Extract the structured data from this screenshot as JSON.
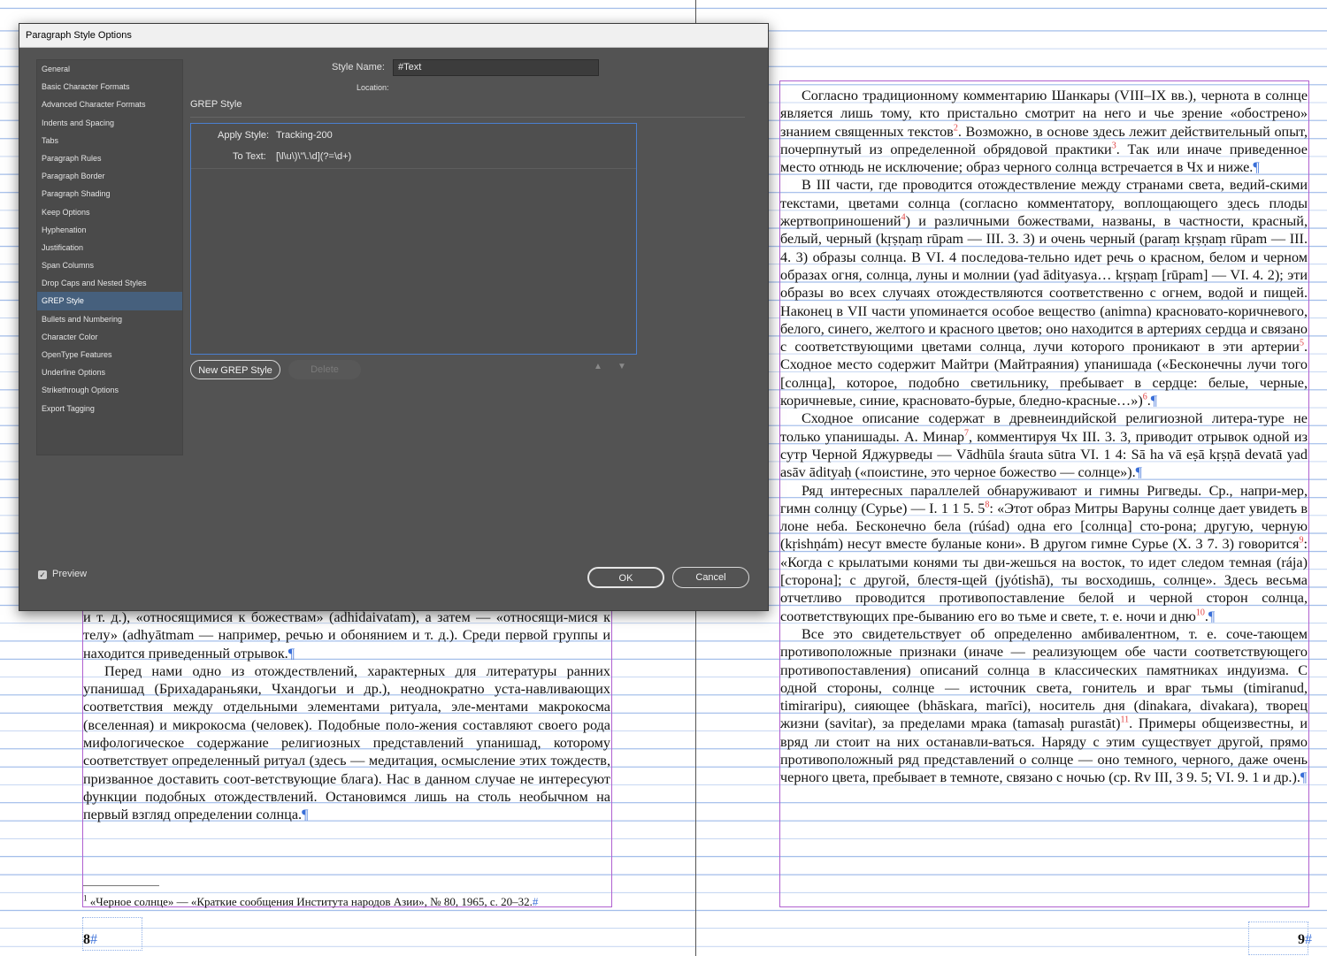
{
  "dialog": {
    "title": "Paragraph Style Options",
    "sidebar": [
      "General",
      "Basic Character Formats",
      "Advanced Character Formats",
      "Indents and Spacing",
      "Tabs",
      "Paragraph Rules",
      "Paragraph Border",
      "Paragraph Shading",
      "Keep Options",
      "Hyphenation",
      "Justification",
      "Span Columns",
      "Drop Caps and Nested Styles",
      "GREP Style",
      "Bullets and Numbering",
      "Character Color",
      "OpenType Features",
      "Underline Options",
      "Strikethrough Options",
      "Export Tagging"
    ],
    "selected_index": 13,
    "style_name_label": "Style Name:",
    "style_name_value": "#Text",
    "location_label": "Location:",
    "section_title": "GREP Style",
    "apply_style_label": "Apply Style:",
    "apply_style_value": "Tracking-200",
    "to_text_label": "To Text:",
    "to_text_value": "[\\l\\u\\)\\\"\\.\\d](?=\\d+)",
    "new_grep_button": "New GREP Style",
    "delete_button": "Delete",
    "up_arrow": "▲",
    "down_arrow": "▼",
    "preview_label": "Preview",
    "preview_checked": true,
    "ok_button": "OK",
    "cancel_button": "Cancel"
  },
  "left_page": {
    "paragraphs": [
      {
        "indent": false,
        "text": "и т. д.), «относящимися к божествам» (adhidaivatam), а затем — «относящи-мися к телу» (adhyātmam — например, речью и обонянием и т. д.). Среди первой группы и находится приведенный отрывок."
      },
      {
        "indent": true,
        "text": "Перед нами одно из отождествлений, характерных для литературы ранних упанишад (Брихадараньяки, Чхандогьи и др.), неоднократно уста-навливающих соответствия между отдельными элементами ритуала, эле-ментами макрокосма (вселенная) и микрокосма (человек). Подобные поло-жения составляют своего рода мифологическое содержание религиозных представлений упанишад, которому соответствует определенный ритуал (здесь — медитация, осмысление этих тождеств, призванное доставить соот-ветствующие блага). Нас в данном случае не интересуют функции подобных отождествлений. Остановимся лишь на столь необычном на первый взгляд определении солнца."
      }
    ],
    "footnote": "«Черное солнце» — «Краткие сообщения Института народов Азии», № 80, 1965, с. 20–32.",
    "footnote_mark": "1",
    "page_number": "8"
  },
  "right_page": {
    "paragraphs": [
      {
        "parts": [
          "Согласно традиционному комментарию Шанкары (VIII–IX вв.), чернота в солнце является лишь тому, кто пристально смотрит на него и чье зрение «обострено» знанием священных текстов",
          {
            "sup": "2"
          },
          ". Возможно, в основе здесь лежит действительный опыт, почерпнутый из определенной обрядовой практики",
          {
            "sup": "3"
          },
          ". Так или иначе приведенное место отнюдь не исключение; образ черного солнца встречается в Чх и ниже."
        ]
      },
      {
        "parts": [
          "В III части, где проводится отождествление между странами света, ведий-скими текстами, цветами солнца (согласно комментатору, воплощающего здесь плоды жертвоприношений",
          {
            "sup": "4"
          },
          ") и различными божествами, названы, в частности, красный, белый, черный (kṛṣṇaṃ rūpam — III. 3. 3) и очень черный (paraṃ kṛṣṇaṃ rūpam — III. 4. 3) образы солнца. В VI. 4 последова-тельно идет речь о красном, белом и черном образах огня, солнца, луны и молнии (yad ādityasya… kṛṣṇaṃ [rūpam] — VI. 4. 2); эти образы во всех случаях отождествляются соответственно с огнем, водой и пищей. Наконец в VII части упоминается особое вещество (animna) красновато-коричневого, белого, синего, желтого и красного цветов; оно находится в артериях сердца и связано с соответствующими цветами солнца, лучи которого проникают в эти артерии",
          {
            "sup": "5"
          },
          ". Сходное место содержит Майтри (Майтраяния) упанишада («Бесконечны лучи того [солнца], которое, подобно светильнику, пребывает в сердце: белые, черные, коричневые, синие, красновато-бурые, бледно-красные…»)",
          {
            "sup": "6"
          },
          "."
        ]
      },
      {
        "parts": [
          "Сходное описание содержат в древнеиндийской религиозной литера-туре не только упанишады. А. Минар",
          {
            "sup": "7"
          },
          ", комментируя Чх III. 3. 3, приводит отрывок одной из сутр Черной Яджурведы — Vādhūla śrauta sūtra VI. 1 4: Sā ha vā eṣā kṛṣṇā devatā yad asāv ādityaḥ («поистине, это черное божество — солнце»)."
        ]
      },
      {
        "parts": [
          "Ряд интересных параллелей обнаруживают и гимны Ригведы. Ср., напри-мер, гимн солнцу (Сурье) — I. 1 1 5. 5",
          {
            "sup": "8"
          },
          ": «Этот образ Митры Варуны солнце дает увидеть в лоне неба. Бесконечно бела (rúśad) одна его [солнца] сто-рона; другую, черную (kṛishṇám) несут вместе буланые кони». В другом гимне Сурье (X. 3 7. 3) говорится",
          {
            "sup": "9"
          },
          ": «Когда с крылатыми конями ты дви-жешься на восток, то идет следом темная (rája) [сторона]; с другой, блестя-щей (jyótishā), ты восходишь, солнце». Здесь весьма отчетливо проводится противопоставление белой и черной сторон солнца, соответствующих пре-быванию его во тьме и свете, т. е. ночи и дню",
          {
            "sup": "10"
          },
          "."
        ]
      },
      {
        "parts": [
          "Все это свидетельствует об определенно амбивалентном, т. е. соче-тающем противоположные признаки (иначе — реализующем обе части соответствующего противопоставления) описаний солнца в классических памятниках индуизма. С одной стороны, солнце — источник света, гонитель и враг тьмы (timiranud, timiraripu), сияющее (bhāskara, marīci), носитель дня (dinakara, divakara), творец жизни (savitar), за пределами мрака (tamasaḥ purastāt)",
          {
            "sup": "11"
          },
          ". Примеры общеизвестны, и вряд ли стоит на них останавли-ваться. Наряду с этим существует другой, прямо противоположный ряд представлений о солнце — оно темного, черного, даже очень черного цвета, пребывает в темноте, связано с ночью (ср. Rv III, 3 9. 5; VI. 9. 1 и др.)."
        ]
      }
    ],
    "page_number": "9"
  },
  "pilcrow": "¶",
  "hash_mark": "#"
}
